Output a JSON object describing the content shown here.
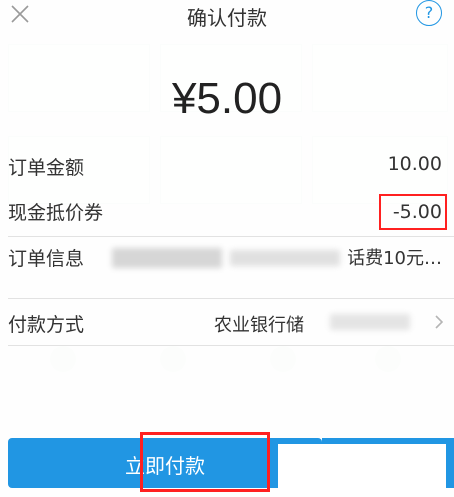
{
  "header": {
    "title": "确认付款",
    "help_glyph": "?"
  },
  "amount": "¥5.00",
  "rows": {
    "order_amount": {
      "label": "订单金额",
      "value": "10.00"
    },
    "cash_voucher": {
      "label": "现金抵价券",
      "value": "-5.00"
    },
    "order_info": {
      "label": "订单信息",
      "value": "话费10元…"
    },
    "payment_method": {
      "label": "付款方式",
      "value": "农业银行储"
    }
  },
  "pay_button": {
    "label": "立即付款"
  },
  "colors": {
    "accent": "#2196e3",
    "highlight": "#ff2020"
  },
  "icons": {
    "close": "close-icon",
    "help": "help-icon",
    "chevron": "chevron-right-icon"
  }
}
